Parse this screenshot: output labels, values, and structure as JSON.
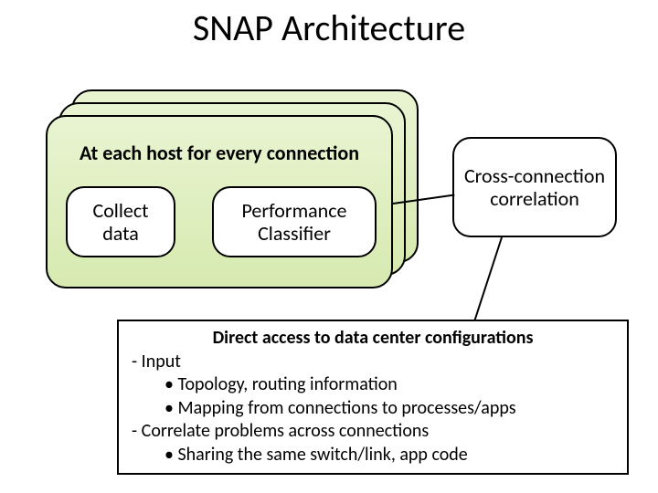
{
  "title": "SNAP Architecture",
  "stack_label": "At each host for every connection",
  "boxes": {
    "collect": "Collect data",
    "perf": "Performance Classifier",
    "cross": "Cross-connection correlation"
  },
  "textbox": {
    "heading": "Direct access to data center configurations",
    "lines": [
      {
        "level": 1,
        "marker": "dash",
        "text": "Input"
      },
      {
        "level": 2,
        "marker": "bullet",
        "text": "Topology, routing information"
      },
      {
        "level": 2,
        "marker": "bullet",
        "text": "Mapping from connections to processes/apps"
      },
      {
        "level": 1,
        "marker": "dash",
        "text": "Correlate problems across connections"
      },
      {
        "level": 2,
        "marker": "bullet",
        "text": "Sharing the same switch/link, app code"
      }
    ]
  }
}
